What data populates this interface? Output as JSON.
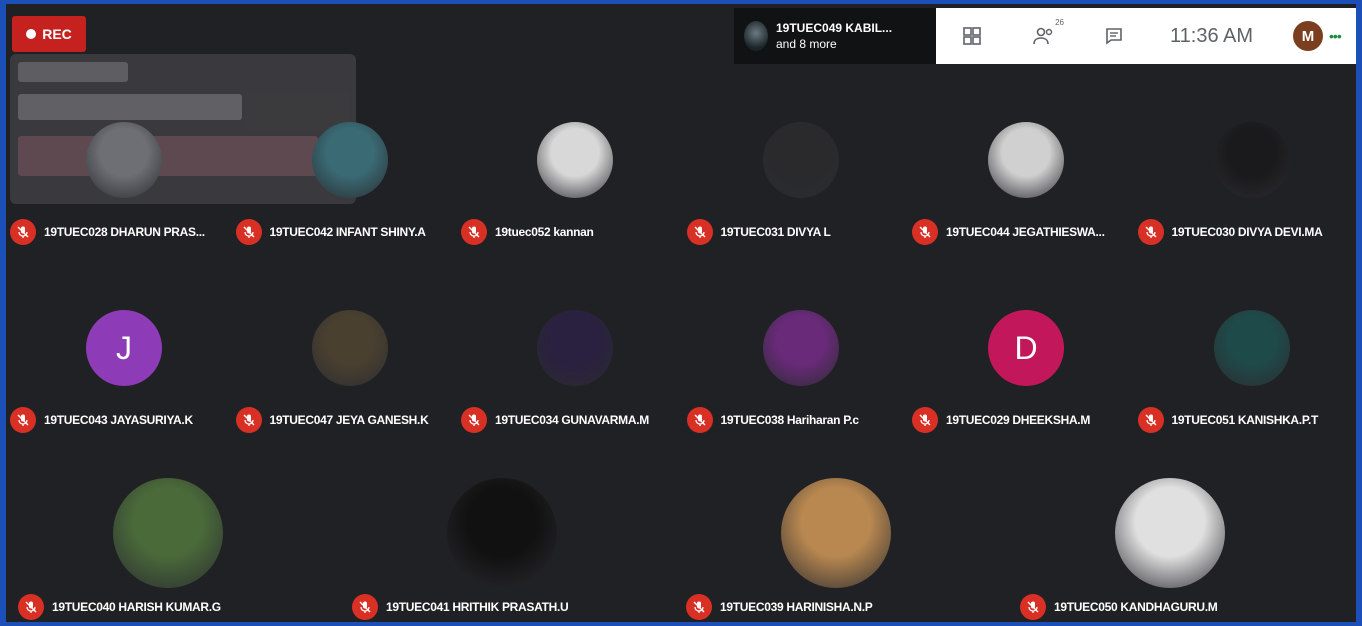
{
  "rec": {
    "label": "REC"
  },
  "presenter": {
    "name": "19TUEC049 KABIL...",
    "more": "and 8 more"
  },
  "topbar": {
    "people_count": "26",
    "clock": "11:36 AM",
    "avatar_letter": "M",
    "dots": "•••"
  },
  "participants": [
    {
      "name": "19TUEC028 DHARUN PRAS...",
      "avatar": "photo",
      "color": "#6d6f74"
    },
    {
      "name": "19TUEC042 INFANT SHINY.A",
      "avatar": "photo",
      "color": "#3a6a74"
    },
    {
      "name": "19tuec052 kannan",
      "avatar": "photo",
      "color": "#d8d8d8"
    },
    {
      "name": "19TUEC031 DIVYA L",
      "avatar": "photo",
      "color": "#2a2a2c"
    },
    {
      "name": "19TUEC044 JEGATHIESWA...",
      "avatar": "photo",
      "color": "#d0d0d0"
    },
    {
      "name": "19TUEC030 DIVYA DEVI.MA",
      "avatar": "photo",
      "color": "#1a1a1c"
    },
    {
      "name": "19TUEC043 JAYASURIYA.K",
      "avatar": "letter",
      "letter": "J",
      "color": "#8e3bb8"
    },
    {
      "name": "19TUEC047 JEYA GANESH.K",
      "avatar": "photo",
      "color": "#4a4030"
    },
    {
      "name": "19TUEC034 GUNAVARMA.M",
      "avatar": "photo",
      "color": "#2a2040"
    },
    {
      "name": "19TUEC038 Hariharan P.c",
      "avatar": "photo",
      "color": "#6a2a7a"
    },
    {
      "name": "19TUEC029 DHEEKSHA.M",
      "avatar": "letter",
      "letter": "D",
      "color": "#c2185b"
    },
    {
      "name": "19TUEC051 KANISHKA.P.T",
      "avatar": "photo",
      "color": "#1f4a4a"
    },
    {
      "name": "19TUEC040 HARISH KUMAR.G",
      "avatar": "photo",
      "color": "#4a6a3a"
    },
    {
      "name": "19TUEC041 HRITHIK PRASATH.U",
      "avatar": "photo",
      "color": "#111111"
    },
    {
      "name": "19TUEC039 HARINISHA.N.P",
      "avatar": "photo",
      "color": "#b98850"
    },
    {
      "name": "19TUEC050 KANDHAGURU.M",
      "avatar": "photo",
      "color": "#e0e0e0"
    }
  ]
}
